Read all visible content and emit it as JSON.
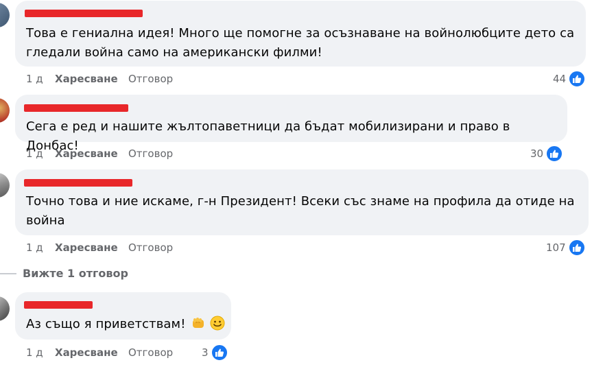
{
  "comments": [
    {
      "text": "Това е гениална идея! Много ще помогне за осъзнаване на войнолюбците дето са гледали война само на американски филми!",
      "time": "1 д",
      "like_label": "Харесване",
      "reply_label": "Отговор",
      "reaction_count": "44"
    },
    {
      "text": "Сега е ред и нашите жълтопаветници да бъдат мобилизирани и право в Донбас!",
      "time": "1 д",
      "like_label": "Харесване",
      "reply_label": "Отговор",
      "reaction_count": "30"
    },
    {
      "text": "Точно това и ние искаме, г-н Президент! Всеки със знаме на профила да отиде на война",
      "time": "1 д",
      "like_label": "Харесване",
      "reply_label": "Отговор",
      "reaction_count": "107"
    },
    {
      "text": "Аз също я приветствам!",
      "time": "1 д",
      "like_label": "Харесване",
      "reply_label": "Отговор",
      "reaction_count": "3"
    }
  ],
  "view_replies_label": "Вижте 1 отговор",
  "colors": {
    "bubble": "#f0f2f5",
    "redaction": "#e8272a",
    "like_blue": "#1877f2",
    "meta_gray": "#65676b"
  },
  "icons": [
    "thumbs-up-icon",
    "fist-emoji-icon",
    "smile-emoji-icon"
  ]
}
